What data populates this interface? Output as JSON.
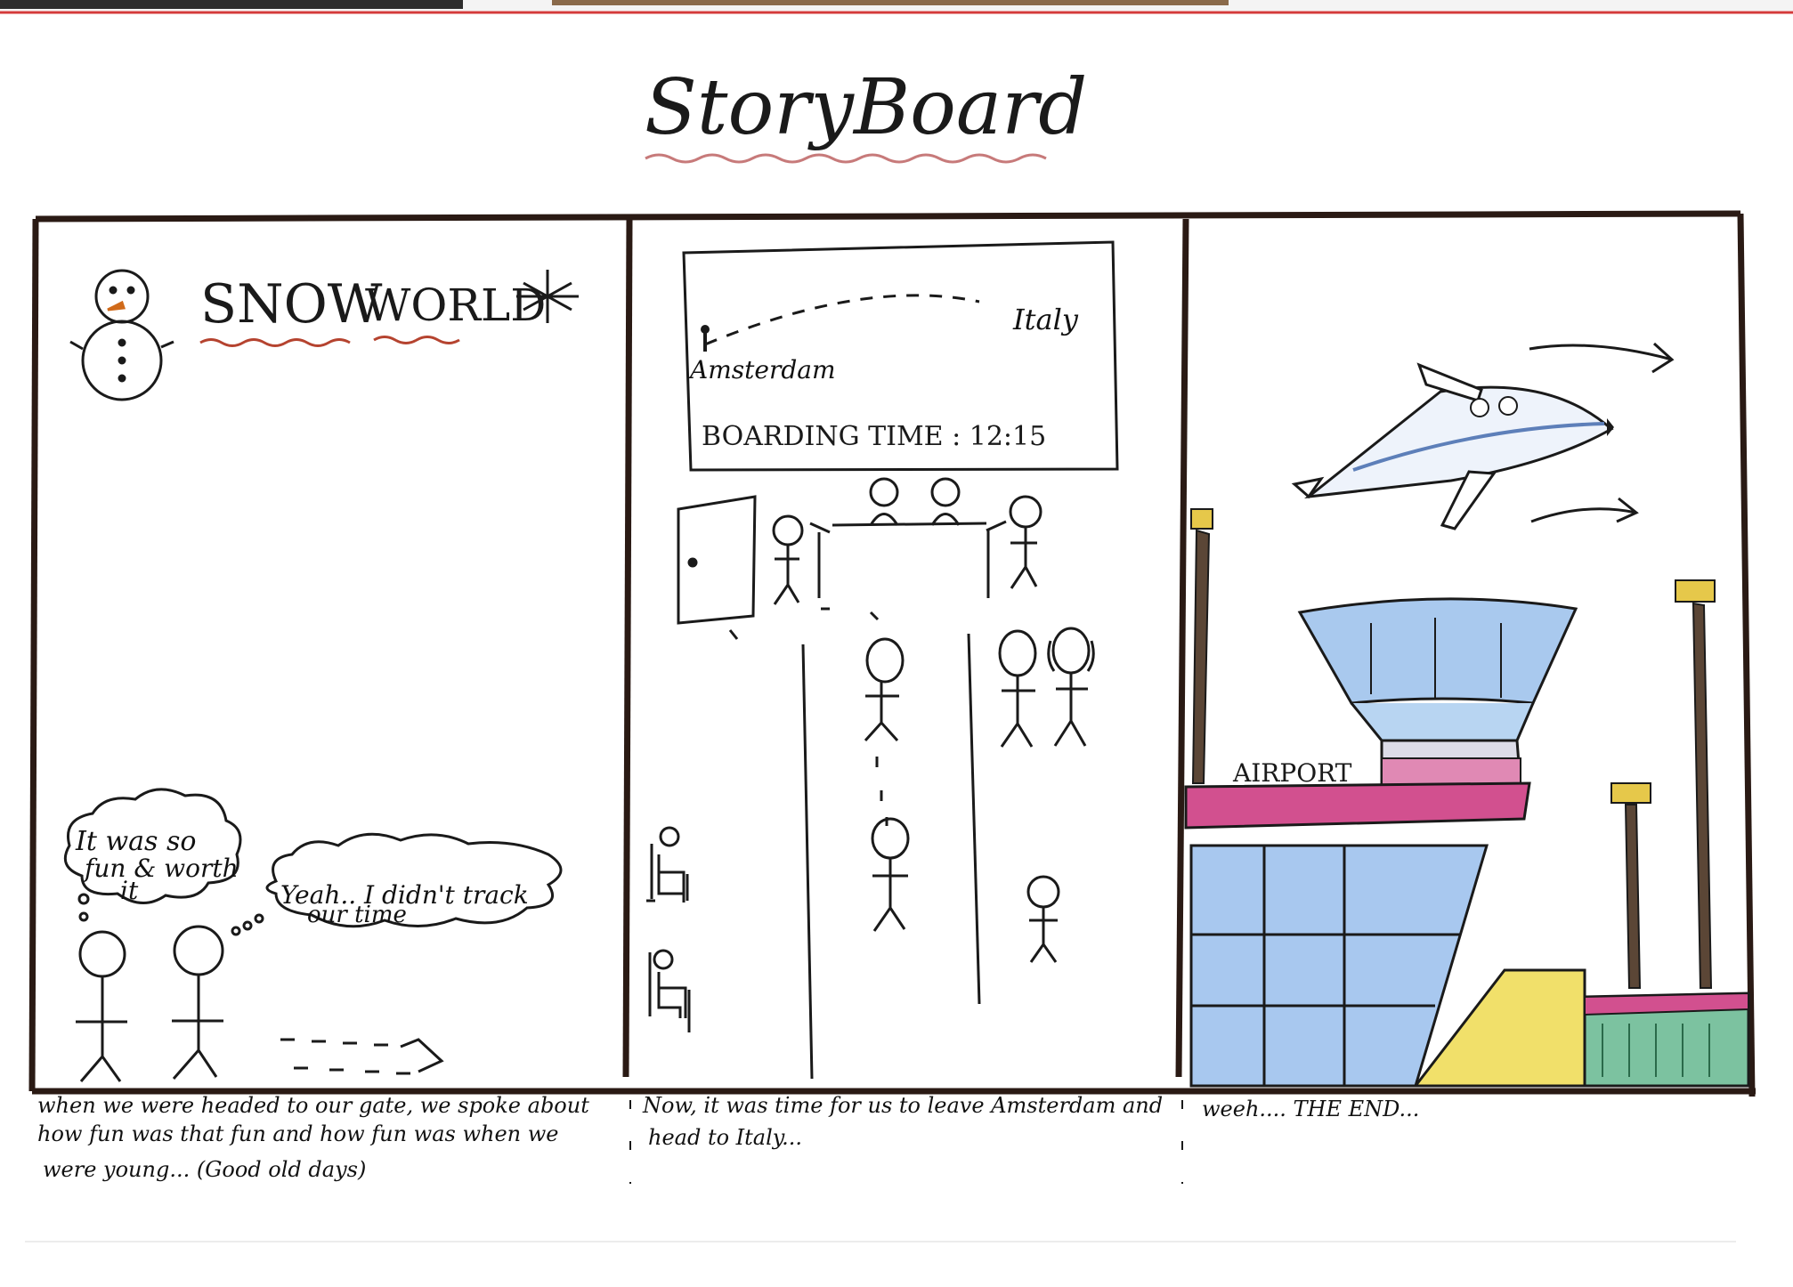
{
  "title": "StoryBoard",
  "panel1": {
    "heading_left": "SNOW",
    "heading_right": "WORLD",
    "bubble1": [
      "It was so",
      "fun & worth",
      "it"
    ],
    "bubble2": [
      "Yeah.. I didn't track",
      "our time"
    ]
  },
  "panel2": {
    "origin": "Amsterdam",
    "destination": "Italy",
    "boarding": "BOARDING TIME : 12:15"
  },
  "panel3": {
    "sign": "AIRPORT"
  },
  "captions": {
    "c1": [
      "when we were headed to our gate, we spoke about",
      "how fun was that fun and how fun was when we",
      "were young... (Good old days)"
    ],
    "c2": [
      "Now, it was time for us to leave Amsterdam and",
      "head to Italy..."
    ],
    "c3": [
      "weeh....   THE END..."
    ]
  },
  "colors": {
    "ink": "#1a1a1a",
    "frame": "#2a1a14",
    "pink": "#d2508f",
    "blue": "#8fb7e6",
    "yellow": "#f1e06a",
    "green": "#7cc2a0",
    "pole": "#5b4636",
    "title_wave": "#c77a7a"
  }
}
